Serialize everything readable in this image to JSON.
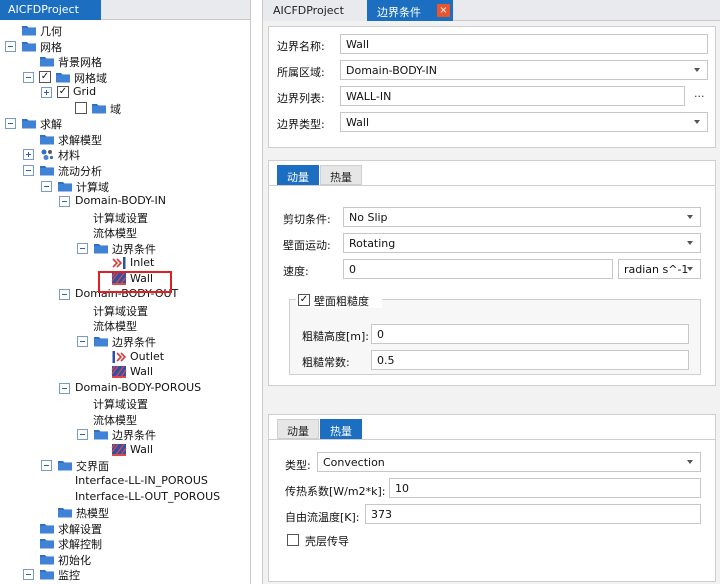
{
  "left_tab": "AICFDProject",
  "tree": [
    {
      "label": "几何",
      "depth": 0,
      "icon": "folder-icon"
    },
    {
      "label": "网格",
      "depth": 0,
      "icon": "folder-icon",
      "expander": "minus"
    },
    {
      "label": "背景网格",
      "depth": 1,
      "icon": "folder-icon"
    },
    {
      "label": "网格域",
      "depth": 1,
      "icon": "folder-icon",
      "expander": "minus",
      "checked": true
    },
    {
      "label": "Grid",
      "depth": 2,
      "expander": "plus",
      "checked": true
    },
    {
      "label": "域",
      "depth": 3,
      "icon": "folder-icon",
      "checked": false
    },
    {
      "label": "求解",
      "depth": 0,
      "icon": "folder-icon",
      "expander": "minus"
    },
    {
      "label": "求解模型",
      "depth": 1,
      "icon": "folder-icon"
    },
    {
      "label": "材料",
      "depth": 1,
      "icon": "material-icon",
      "expander": "plus"
    },
    {
      "label": "流动分析",
      "depth": 1,
      "icon": "folder-icon",
      "expander": "minus"
    },
    {
      "label": "计算域",
      "depth": 2,
      "icon": "folder-icon",
      "expander": "minus"
    },
    {
      "label": "Domain-BODY-IN",
      "depth": 3,
      "expander": "minus"
    },
    {
      "label": "计算域设置",
      "depth": 4
    },
    {
      "label": "流体模型",
      "depth": 4
    },
    {
      "label": "边界条件",
      "depth": 4,
      "icon": "folder-icon",
      "expander": "minus"
    },
    {
      "label": "Inlet",
      "depth": 5,
      "icon": "inlet-icon"
    },
    {
      "label": "Wall",
      "depth": 5,
      "icon": "wall-icon",
      "highlighted": true
    },
    {
      "label": "Domain-BODY-OUT",
      "depth": 3,
      "expander": "minus"
    },
    {
      "label": "计算域设置",
      "depth": 4
    },
    {
      "label": "流体模型",
      "depth": 4
    },
    {
      "label": "边界条件",
      "depth": 4,
      "icon": "folder-icon",
      "expander": "minus"
    },
    {
      "label": "Outlet",
      "depth": 5,
      "icon": "outlet-icon"
    },
    {
      "label": "Wall",
      "depth": 5,
      "icon": "wall-icon"
    },
    {
      "label": "Domain-BODY-POROUS",
      "depth": 3,
      "expander": "minus"
    },
    {
      "label": "计算域设置",
      "depth": 4
    },
    {
      "label": "流体模型",
      "depth": 4
    },
    {
      "label": "边界条件",
      "depth": 4,
      "icon": "folder-icon",
      "expander": "minus"
    },
    {
      "label": "Wall",
      "depth": 5,
      "icon": "wall-icon"
    },
    {
      "label": "交界面",
      "depth": 2,
      "icon": "folder-icon",
      "expander": "minus"
    },
    {
      "label": "Interface-LL-IN_POROUS",
      "depth": 3
    },
    {
      "label": "Interface-LL-OUT_POROUS",
      "depth": 3
    },
    {
      "label": "热模型",
      "depth": 2,
      "icon": "folder-icon"
    },
    {
      "label": "求解设置",
      "depth": 1,
      "icon": "folder-icon"
    },
    {
      "label": "求解控制",
      "depth": 1,
      "icon": "folder-icon"
    },
    {
      "label": "初始化",
      "depth": 1,
      "icon": "folder-icon"
    },
    {
      "label": "监控",
      "depth": 1,
      "icon": "folder-icon",
      "expander": "minus"
    }
  ],
  "right_tabs": {
    "project": "AICFDProject",
    "boundary": "边界条件",
    "close": "×"
  },
  "boundary": {
    "name_label": "边界名称:",
    "name_value": "Wall",
    "region_label": "所属区域:",
    "region_value": "Domain-BODY-IN",
    "list_label": "边界列表:",
    "list_value": "WALL-IN",
    "list_more": "...",
    "type_label": "边界类型:",
    "type_value": "Wall"
  },
  "momentum_group": {
    "tab_momentum": "动量",
    "tab_heat": "热量",
    "shear_label": "剪切条件:",
    "shear_value": "No Slip",
    "motion_label": "壁面运动:",
    "motion_value": "Rotating",
    "speed_label": "速度:",
    "speed_value": "0",
    "speed_unit": "radian s^-1",
    "roughness_label": "壁面粗糙度",
    "roughness_checked": true,
    "rough_height_label": "粗糙高度[m]:",
    "rough_height_value": "0",
    "rough_const_label": "粗糙常数:",
    "rough_const_value": "0.5"
  },
  "heat_group": {
    "tab_momentum": "动量",
    "tab_heat": "热量",
    "type_label": "类型:",
    "type_value": "Convection",
    "coef_label": "传热系数[W/m2*k]:",
    "coef_value": "10",
    "temp_label": "自由流温度[K]:",
    "temp_value": "373",
    "shell_label": "壳层传导",
    "shell_checked": false
  },
  "colors": {
    "accent": "#1c6ec0",
    "close": "#e8552f",
    "highlight": "#e02020",
    "folder": "#2f6fc4"
  }
}
